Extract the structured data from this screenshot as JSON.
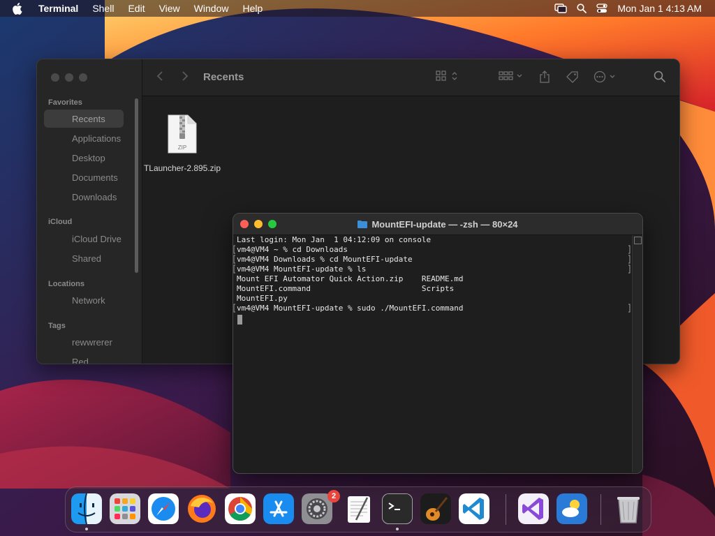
{
  "menubar": {
    "app_name": "Terminal",
    "menus": [
      "Shell",
      "Edit",
      "View",
      "Window",
      "Help"
    ],
    "clock": "Mon Jan 1  4:13 AM"
  },
  "finder": {
    "title": "Recents",
    "sidebar": {
      "sections": {
        "favorites": "Favorites",
        "icloud": "iCloud",
        "locations": "Locations",
        "tags": "Tags"
      },
      "items": {
        "recents": "Recents",
        "applications": "Applications",
        "desktop": "Desktop",
        "documents": "Documents",
        "downloads": "Downloads",
        "icloud_drive": "iCloud Drive",
        "shared": "Shared",
        "network": "Network",
        "tag1": "rewwrerer",
        "tag2": "Red"
      }
    },
    "file": {
      "name": "TLauncher-2.895.zip",
      "badge": "ZIP"
    }
  },
  "terminal": {
    "title": "MountEFI-update — -zsh — 80×24",
    "lines": [
      "Last login: Mon Jan  1 04:12:09 on console",
      "vm4@VM4 ~ % cd Downloads",
      "vm4@VM4 Downloads % cd MountEFI-update",
      "vm4@VM4 MountEFI-update % ls",
      "Mount EFI Automator Quick Action.zip    README.md",
      "MountEFI.command                        Scripts",
      "MountEFI.py",
      "vm4@VM4 MountEFI-update % sudo ./MountEFI.command"
    ]
  },
  "dock": {
    "apps": [
      "Finder",
      "Launchpad",
      "Safari",
      "Firefox",
      "Chrome",
      "App Store",
      "System Settings",
      "TextEdit",
      "Terminal",
      "GarageBand",
      "Visual Studio Code",
      "Visual Studio",
      "Weather",
      "Trash"
    ],
    "settings_badge": "2"
  }
}
